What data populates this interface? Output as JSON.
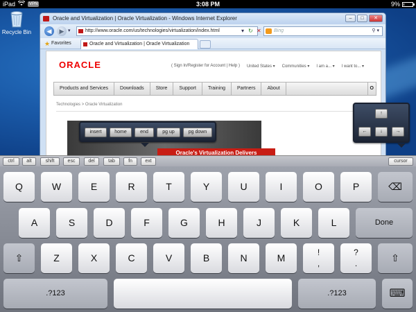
{
  "statusbar": {
    "device": "iPad",
    "vpn": "VPN",
    "time": "3:08 PM",
    "battery": "9%",
    "battery_level": 0.09
  },
  "desktop": {
    "recycle_bin": "Recycle Bin"
  },
  "browser": {
    "title": "Oracle and Virtualization | Oracle Virtualization - Windows Internet Explorer",
    "url": "http://www.oracle.com/us/technologies/virtualization/index.html",
    "search_placeholder": "Bing",
    "favorites_label": "Favorites",
    "tab_label": "Oracle and Virtualization | Oracle Virtualization"
  },
  "webpage": {
    "logo": "ORACLE",
    "top_links": [
      "( Sign In/Register for Account | Help )",
      "United States ▾",
      "Communities ▾",
      "I am a... ▾",
      "I want to... ▾"
    ],
    "menu": [
      "Products and Services",
      "Downloads",
      "Store",
      "Support",
      "Training",
      "Partners",
      "About"
    ],
    "menu_more": "O",
    "breadcrumb": "Technologies  >  Oracle Virtualization",
    "hero_banner": "Oracle's Virtualization Delivers"
  },
  "nav_popup": {
    "keys": [
      "insert",
      "home",
      "end",
      "pg up",
      "pg down"
    ]
  },
  "arrow_popup": {
    "up": "↑",
    "left": "←",
    "down": "↓",
    "right": "→"
  },
  "modifier_bar": {
    "keys": [
      "ctrl",
      "alt",
      "shift",
      "esc",
      "del",
      "tab",
      "fn",
      "ext"
    ],
    "cursor": "cursor"
  },
  "keyboard": {
    "row1": [
      "Q",
      "W",
      "E",
      "R",
      "T",
      "Y",
      "U",
      "I",
      "O",
      "P"
    ],
    "row2": [
      "A",
      "S",
      "D",
      "F",
      "G",
      "H",
      "J",
      "K",
      "L"
    ],
    "row3": [
      "Z",
      "X",
      "C",
      "V",
      "B",
      "N",
      "M"
    ],
    "done": "Done",
    "punct1_top": "!",
    "punct1_bottom": ",",
    "punct2_top": "?",
    "punct2_bottom": ".",
    "numbers_left": ".?123",
    "numbers_right": ".?123",
    "backspace_icon": "⌫",
    "shift_icon": "⇧",
    "hide_keyboard_icon": "⌨"
  }
}
